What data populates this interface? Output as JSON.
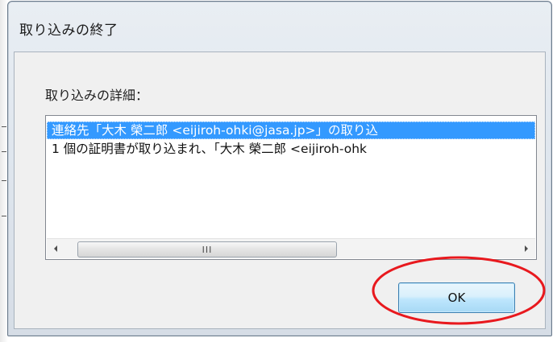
{
  "window": {
    "title": "取り込みの終了"
  },
  "details": {
    "label": "取り込みの詳細：",
    "rows": [
      "連絡先「大木 榮二郎 <eijiroh-ohki@jasa.jp>」の取り込",
      "1 個の証明書が取り込まれ、「大木 榮二郎 <eijiroh-ohk"
    ],
    "selected_index": 0
  },
  "scrollbar": {
    "thumb_grip": "III"
  },
  "buttons": {
    "ok_label": "OK"
  },
  "annotation": {
    "color": "#e8191e"
  },
  "icons": {
    "scroll_left": "scroll-left-arrow-icon",
    "scroll_right": "scroll-right-arrow-icon"
  }
}
